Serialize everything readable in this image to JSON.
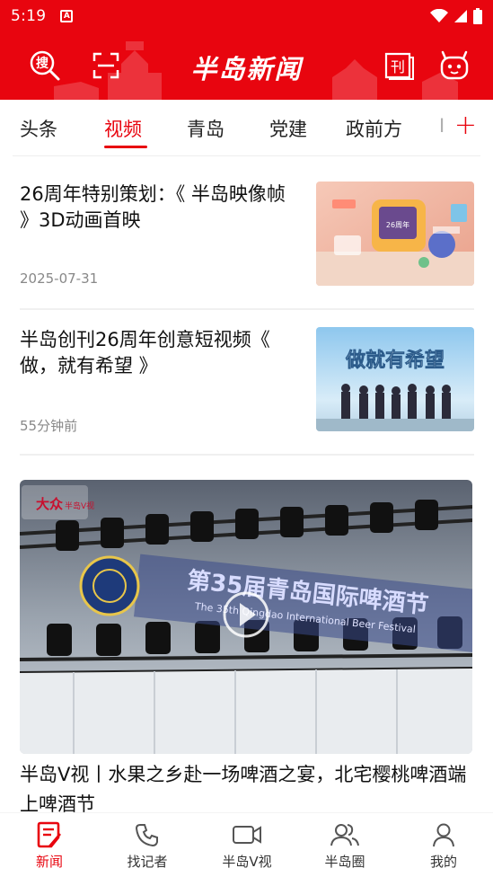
{
  "status_bar": {
    "time": "5:19",
    "notification_icon": "A"
  },
  "header": {
    "logo_text": "半岛新闻",
    "left_icons": [
      "search-icon",
      "scan-icon"
    ],
    "right_icons": [
      "epaper-icon",
      "robot-icon"
    ],
    "search_icon_char": "搜",
    "epaper_icon_char": "刊"
  },
  "tabs": {
    "items": [
      "头条",
      "视频",
      "青岛",
      "党建",
      "政前方"
    ],
    "active": "视频",
    "partial": "I",
    "add_label": "+"
  },
  "news": [
    {
      "title": "26周年特别策划：《 半岛映像帧 》3D动画首映",
      "meta": "2025-07-31",
      "thumb_text": "26周年"
    },
    {
      "title": "半岛创刊26周年创意短视频《 做，就有希望 》",
      "meta": "55分钟前",
      "thumb_text": "做就有希望"
    }
  ],
  "video": {
    "banner_text": "第35届青岛国际啤酒节",
    "banner_en": "The 35th Qingdao International Beer Festival",
    "watermark": "大众",
    "watermark_tag": "半岛V视",
    "title": "半岛V视丨水果之乡赴一场啤酒之宴，北宅樱桃啤酒端上啤酒节"
  },
  "bottom_nav": {
    "items": [
      "新闻",
      "找记者",
      "半岛V视",
      "半岛圈",
      "我的"
    ],
    "active": "新闻"
  },
  "colors": {
    "brand_red": "#e8050f",
    "text": "#222222",
    "meta": "#888888"
  }
}
